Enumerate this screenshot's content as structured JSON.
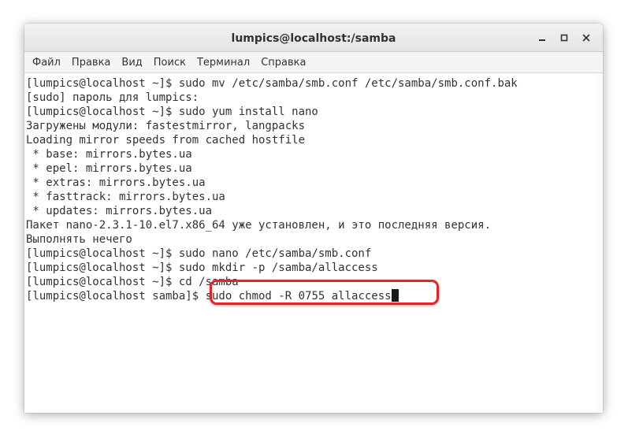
{
  "window": {
    "title": "lumpics@localhost:/samba"
  },
  "menu": [
    {
      "name": "menu-file",
      "label": "Файл"
    },
    {
      "name": "menu-edit",
      "label": "Правка"
    },
    {
      "name": "menu-view",
      "label": "Вид"
    },
    {
      "name": "menu-search",
      "label": "Поиск"
    },
    {
      "name": "menu-terminal",
      "label": "Терминал"
    },
    {
      "name": "menu-help",
      "label": "Справка"
    }
  ],
  "terminal": {
    "lines": [
      "[lumpics@localhost ~]$ sudo mv /etc/samba/smb.conf /etc/samba/smb.conf.bak",
      "[sudo] пароль для lumpics:",
      "[lumpics@localhost ~]$ sudo yum install nano",
      "Загружены модули: fastestmirror, langpacks",
      "Loading mirror speeds from cached hostfile",
      " * base: mirrors.bytes.ua",
      " * epel: mirrors.bytes.ua",
      " * extras: mirrors.bytes.ua",
      " * fasttrack: mirrors.bytes.ua",
      " * updates: mirrors.bytes.ua",
      "Пакет nano-2.3.1-10.el7.x86_64 уже установлен, и это последняя версия.",
      "Выполнять нечего",
      "[lumpics@localhost ~]$ sudo nano /etc/samba/smb.conf",
      "[lumpics@localhost ~]$ sudo mkdir -p /samba/allaccess",
      "[lumpics@localhost ~]$ cd /samba"
    ],
    "prompt": "[lumpics@localhost samba]$ ",
    "current_command": "sudo chmod -R 0755 allaccess"
  },
  "colors": {
    "highlight": "#e3242b",
    "text": "#2e3436"
  }
}
